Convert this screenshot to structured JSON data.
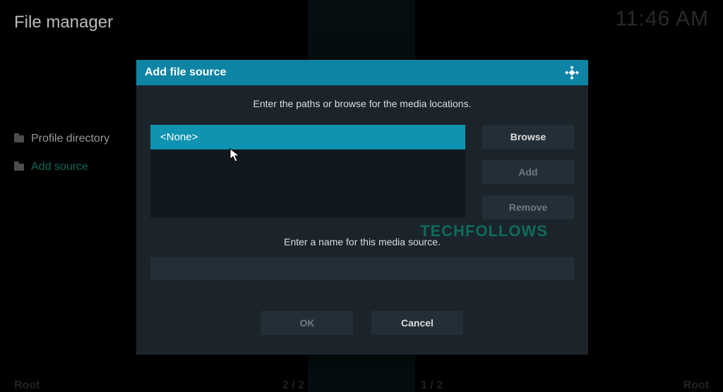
{
  "header": {
    "title": "File manager",
    "clock": "11:46 AM"
  },
  "sidebar": {
    "items": [
      {
        "label": "Profile directory"
      },
      {
        "label": "Add source"
      }
    ]
  },
  "footer": {
    "left_label": "Root",
    "middle_left": "2 / 2",
    "middle_right": "1 / 2",
    "right_label": "Root"
  },
  "dialog": {
    "title": "Add file source",
    "instruction": "Enter the paths or browse for the media locations.",
    "path_value": "<None>",
    "browse_label": "Browse",
    "add_label": "Add",
    "remove_label": "Remove",
    "name_label": "Enter a name for this media source.",
    "name_value": "",
    "ok_label": "OK",
    "cancel_label": "Cancel"
  },
  "watermark": "TECHFOLLOWS"
}
